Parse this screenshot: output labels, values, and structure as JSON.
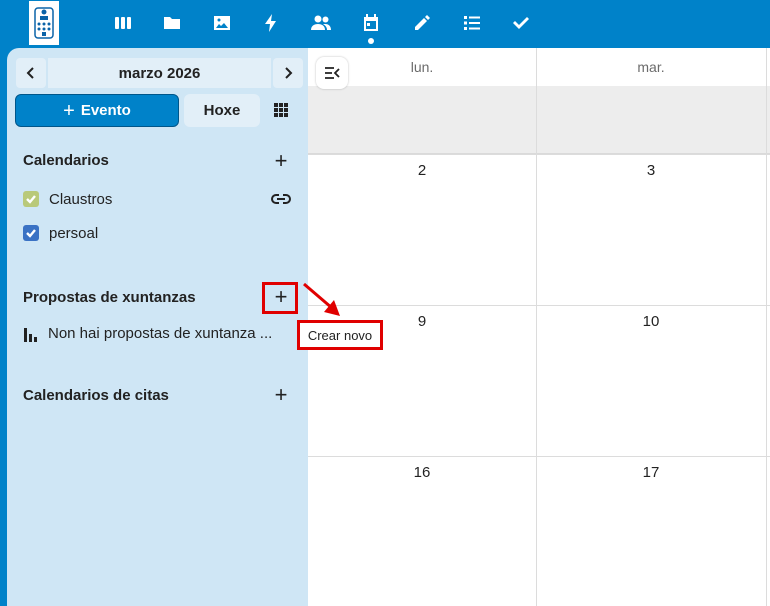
{
  "topbar": {
    "apps": [
      {
        "name": "dashboard-icon"
      },
      {
        "name": "files-icon"
      },
      {
        "name": "photos-icon"
      },
      {
        "name": "activity-icon"
      },
      {
        "name": "contacts-icon"
      },
      {
        "name": "calendar-icon",
        "active": true
      },
      {
        "name": "notes-icon"
      },
      {
        "name": "tasks-list-icon"
      },
      {
        "name": "deck-check-icon"
      }
    ]
  },
  "sidebar": {
    "month_label": "marzo 2026",
    "new_event_label": "Evento",
    "today_label": "Hoxe",
    "calendars_title": "Calendarios",
    "calendars": [
      {
        "label": "Claustros",
        "color": "#b9c97a"
      },
      {
        "label": "persoal",
        "color": "#3a72c4"
      }
    ],
    "proposals_title": "Propostas de xuntanzas",
    "proposals_empty": "Non hai propostas de xuntanza ...",
    "appointments_title": "Calendarios de citas"
  },
  "tooltip": "Crear novo",
  "calendar": {
    "day_headers": [
      "lun.",
      "mar."
    ],
    "week_rows": [
      [
        "2",
        "3"
      ],
      [
        "9",
        "10"
      ],
      [
        "16",
        "17"
      ]
    ]
  },
  "colors": {
    "primary": "#0082c9",
    "sidebar_bg": "#cfe6f5",
    "highlight": "#e00000"
  }
}
